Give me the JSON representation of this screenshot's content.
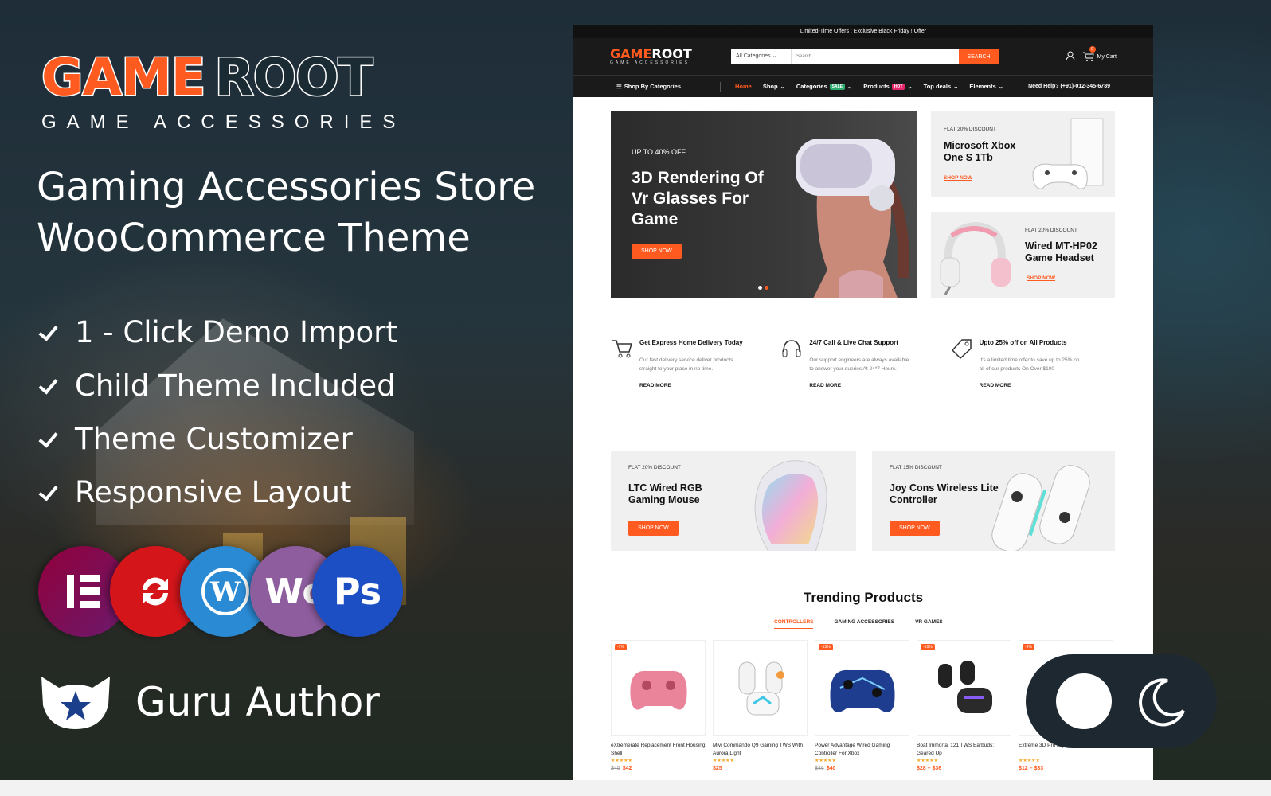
{
  "brand": {
    "logo_game": "GAME",
    "logo_root": "ROOT",
    "logo_sub": "GAME ACCESSORIES",
    "headline_line1": "Gaming Accessories Store",
    "headline_line2": "WooCommerce Theme"
  },
  "features": [
    "1 - Click Demo Import",
    "Child Theme Included",
    "Theme Customizer",
    "Responsive Layout"
  ],
  "badges": [
    {
      "name": "elementor-icon",
      "color": "#92003b"
    },
    {
      "name": "update-icon",
      "color": "#d4161b"
    },
    {
      "name": "wordpress-icon",
      "color": "#2a8ad4"
    },
    {
      "name": "woocommerce-icon",
      "color": "#8e5d9e"
    },
    {
      "name": "photoshop-icon",
      "color": "#1c4fc4"
    }
  ],
  "author": {
    "label": "Guru Author"
  },
  "site": {
    "topbar": "Limited-Time Offers : Exclusive Black Friday ! Offer",
    "logo_game": "GAME",
    "logo_root": "ROOT",
    "logo_sub": "GAME ACCESSORIES",
    "category_select": "All Categories",
    "search_placeholder": "Search...",
    "search_button": "SEARCH",
    "cart_label": "My Cart",
    "cart_count": "0",
    "nav": {
      "shop_by": "Shop By Categories",
      "items": [
        "Home",
        "Shop",
        "Categories",
        "Products",
        "Top deals",
        "Elements"
      ],
      "categories_tag": "SALE",
      "products_tag": "HOT",
      "help": "Need Help? (+91)-012-345-6789"
    },
    "hero": {
      "offer": "UP TO 40% OFF",
      "title": "3D Rendering Of Vr Glasses For Game",
      "button": "SHOP NOW"
    },
    "promos": [
      {
        "label": "FLAT 20% DISCOUNT",
        "title": "Microsoft Xbox One S 1Tb",
        "link": "SHOP NOW"
      },
      {
        "label": "FLAT 20% DISCOUNT",
        "title": "Wired MT-HP02 Game Headset",
        "link": "SHOP NOW"
      },
      {
        "label": "FLAT 20% DISCOUNT",
        "title": "LTC Wired RGB Gaming Mouse",
        "link": "SHOP NOW"
      },
      {
        "label": "FLAT 15% DISCOUNT",
        "title": "Joy Cons Wireless Lite Controller",
        "link": "SHOP NOW"
      }
    ],
    "services": [
      {
        "title": "Get Express Home Delivery Today",
        "desc": "Our fast delivery service deliver products straight to your place in no time.",
        "link": "READ MORE",
        "icon": "cart-icon"
      },
      {
        "title": "24/7 Call & Live Chat Support",
        "desc": "Our support engineers are always available to answer your queries At 24*7 Hours.",
        "link": "READ MORE",
        "icon": "headset-icon"
      },
      {
        "title": "Upto 25% off on All Products",
        "desc": "It's a limited time offer to save up to 25% on all of our products On Over $100",
        "link": "READ MORE",
        "icon": "tag-icon"
      }
    ],
    "trending": {
      "title": "Trending Products",
      "tabs": [
        "CONTROLLERS",
        "GAMING ACCESSORIES",
        "VR GAMES"
      ],
      "products": [
        {
          "discount": "-7%",
          "name": "eXtremerate Replacement Front Housing Shell",
          "old": "$45",
          "price": "$42",
          "color": "#e9849b"
        },
        {
          "discount": "",
          "name": "Mivi Commando Q9 Gaming TWS With Aurora Light",
          "old": "",
          "price": "$25",
          "color": "#f3f3f3"
        },
        {
          "discount": "-13%",
          "name": "Power Advantage Wired Gaming Controller For Xbox",
          "old": "$46",
          "price": "$40",
          "color": "#1e3d8f"
        },
        {
          "discount": "-10%",
          "name": "Boat Immortal 121 TWS Earbuds: Geared Up",
          "old": "",
          "price": "$28 – $36",
          "color": "#222"
        },
        {
          "discount": "-9%",
          "name": "Extreme 3D Pro Joystick Gaming",
          "old": "",
          "price": "$12 – $33",
          "color": "#333"
        }
      ]
    }
  },
  "colors": {
    "accent": "#ff5a1f",
    "dark": "#1a1a1a"
  }
}
